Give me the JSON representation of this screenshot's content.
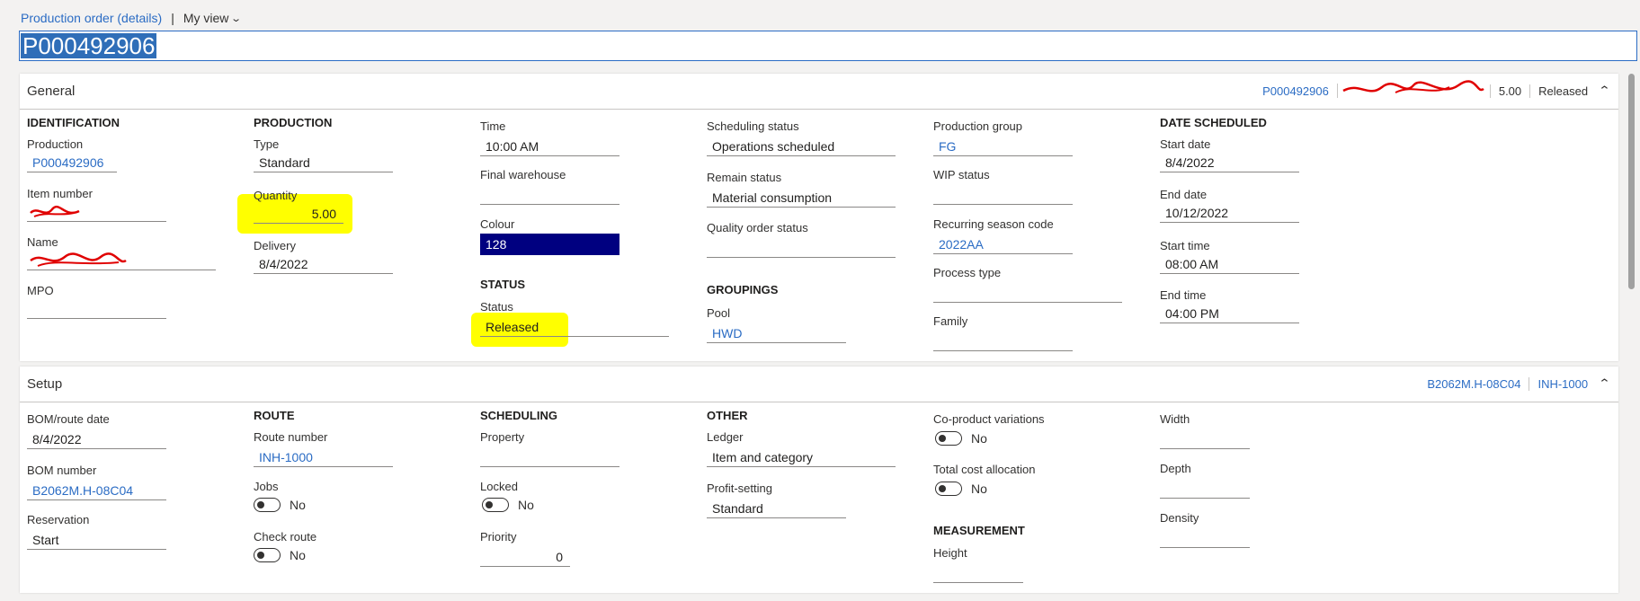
{
  "breadcrumb": {
    "page": "Production order (details)",
    "separator": "|",
    "view": "My view"
  },
  "title": "P000492906",
  "general": {
    "header": "General",
    "summary": [
      "P000492906",
      "5.00",
      "Released"
    ],
    "identification": {
      "group": "IDENTIFICATION",
      "production_label": "Production",
      "production_value": "P000492906",
      "item_label": "Item number",
      "name_label": "Name",
      "mpo_label": "MPO",
      "mpo_value": ""
    },
    "production": {
      "group": "PRODUCTION",
      "type_label": "Type",
      "type_value": "Standard",
      "quantity_label": "Quantity",
      "quantity_value": "5.00",
      "delivery_label": "Delivery",
      "delivery_value": "8/4/2022"
    },
    "col3": {
      "time_label": "Time",
      "time_value": "10:00 AM",
      "warehouse_label": "Final warehouse",
      "warehouse_value": "",
      "colour_label": "Colour",
      "colour_value": "128",
      "status_group": "STATUS",
      "status_label": "Status",
      "status_value": "Released"
    },
    "col4": {
      "sched_label": "Scheduling status",
      "sched_value": "Operations scheduled",
      "remain_label": "Remain status",
      "remain_value": "Material consumption",
      "quality_label": "Quality order status",
      "quality_value": "",
      "groupings": "GROUPINGS",
      "pool_label": "Pool",
      "pool_value": "HWD"
    },
    "col5": {
      "pgroup_label": "Production group",
      "pgroup_value": "FG",
      "wip_label": "WIP status",
      "wip_value": "",
      "season_label": "Recurring season code",
      "season_value": "2022AA",
      "process_label": "Process type",
      "process_value": "",
      "family_label": "Family",
      "family_value": ""
    },
    "dates": {
      "group": "DATE SCHEDULED",
      "start_date_label": "Start date",
      "start_date_value": "8/4/2022",
      "end_date_label": "End date",
      "end_date_value": "10/12/2022",
      "start_time_label": "Start time",
      "start_time_value": "08:00 AM",
      "end_time_label": "End time",
      "end_time_value": "04:00 PM"
    }
  },
  "setup": {
    "header": "Setup",
    "summary": [
      "B2062M.H-08C04",
      "INH-1000"
    ],
    "col1": {
      "bomdate_label": "BOM/route date",
      "bomdate_value": "8/4/2022",
      "bom_label": "BOM number",
      "bom_value": "B2062M.H-08C04",
      "reservation_label": "Reservation",
      "reservation_value": "Start"
    },
    "route": {
      "group": "ROUTE",
      "routenum_label": "Route number",
      "routenum_value": "INH-1000",
      "jobs_label": "Jobs",
      "jobs_value": "No",
      "check_label": "Check route",
      "check_value": "No"
    },
    "scheduling": {
      "group": "SCHEDULING",
      "property_label": "Property",
      "property_value": "",
      "locked_label": "Locked",
      "locked_value": "No",
      "priority_label": "Priority",
      "priority_value": "0"
    },
    "other": {
      "group": "OTHER",
      "ledger_label": "Ledger",
      "ledger_value": "Item and category",
      "profit_label": "Profit-setting",
      "profit_value": "Standard"
    },
    "col5": {
      "coproduct_label": "Co-product variations",
      "coproduct_value": "No",
      "totalcost_label": "Total cost allocation",
      "totalcost_value": "No",
      "measurement": "MEASUREMENT",
      "height_label": "Height",
      "height_value": ""
    },
    "col6": {
      "width_label": "Width",
      "width_value": "",
      "depth_label": "Depth",
      "depth_value": "",
      "density_label": "Density",
      "density_value": ""
    }
  },
  "colors": {
    "accent": "#2b6cc4",
    "highlight": "#ffff00",
    "colour_swatch": "#000080",
    "scribble": "#e00000"
  }
}
